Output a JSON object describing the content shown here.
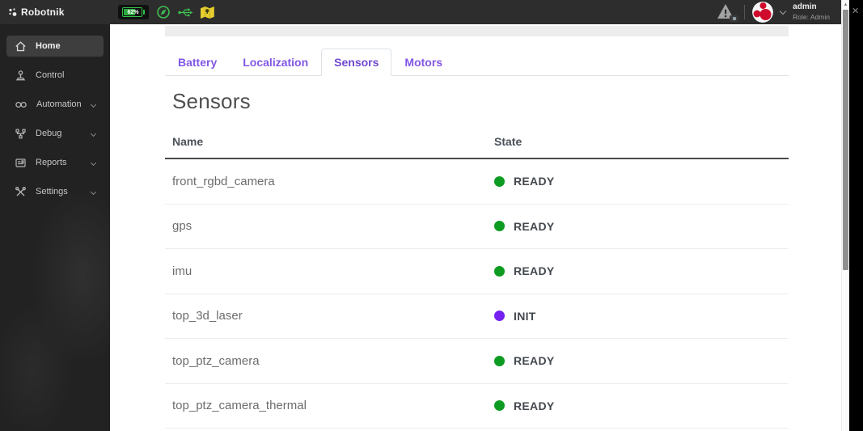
{
  "topbar": {
    "logo_text": "Robotnik",
    "battery": {
      "percent": "62%"
    },
    "status_icons": [
      "compass-icon",
      "usb-icon",
      "map-icon"
    ],
    "notifications": {
      "icon": "warning-triangle-icon"
    },
    "user": {
      "name": "admin",
      "role": "Role: Admin"
    }
  },
  "sidebar": {
    "items": [
      {
        "label": "Home",
        "icon": "home-icon",
        "active": true,
        "expandable": false
      },
      {
        "label": "Control",
        "icon": "joystick-icon",
        "active": false,
        "expandable": false
      },
      {
        "label": "Automation",
        "icon": "automation-icon",
        "active": false,
        "expandable": true
      },
      {
        "label": "Debug",
        "icon": "debug-icon",
        "active": false,
        "expandable": true
      },
      {
        "label": "Reports",
        "icon": "reports-icon",
        "active": false,
        "expandable": true
      },
      {
        "label": "Settings",
        "icon": "settings-icon",
        "active": false,
        "expandable": true
      }
    ]
  },
  "tabs": {
    "items": [
      {
        "label": "Battery",
        "active": false
      },
      {
        "label": "Localization",
        "active": false
      },
      {
        "label": "Sensors",
        "active": true
      },
      {
        "label": "Motors",
        "active": false
      }
    ]
  },
  "main": {
    "title": "Sensors",
    "table": {
      "columns": {
        "name": "Name",
        "state": "State"
      },
      "rows": [
        {
          "name": "front_rgbd_camera",
          "state": "READY",
          "state_color": "#0d9b21"
        },
        {
          "name": "gps",
          "state": "READY",
          "state_color": "#0d9b21"
        },
        {
          "name": "imu",
          "state": "READY",
          "state_color": "#0d9b21"
        },
        {
          "name": "top_3d_laser",
          "state": "INIT",
          "state_color": "#7621f0"
        },
        {
          "name": "top_ptz_camera",
          "state": "READY",
          "state_color": "#0d9b21"
        },
        {
          "name": "top_ptz_camera_thermal",
          "state": "READY",
          "state_color": "#0d9b21"
        }
      ]
    }
  },
  "window_chrome": {
    "close_glyph": "✕",
    "scroll_up_glyph": "▲"
  },
  "colors": {
    "accent_purple": "#8257e5",
    "ready_green": "#0d9b21",
    "init_violet": "#7621f0",
    "topbar_bg": "#2d2d2d",
    "sidebar_bg": "#222222",
    "battery_green": "#35c24a",
    "map_yellow": "#e6cf2e",
    "avatar_red": "#cf0a2c"
  }
}
